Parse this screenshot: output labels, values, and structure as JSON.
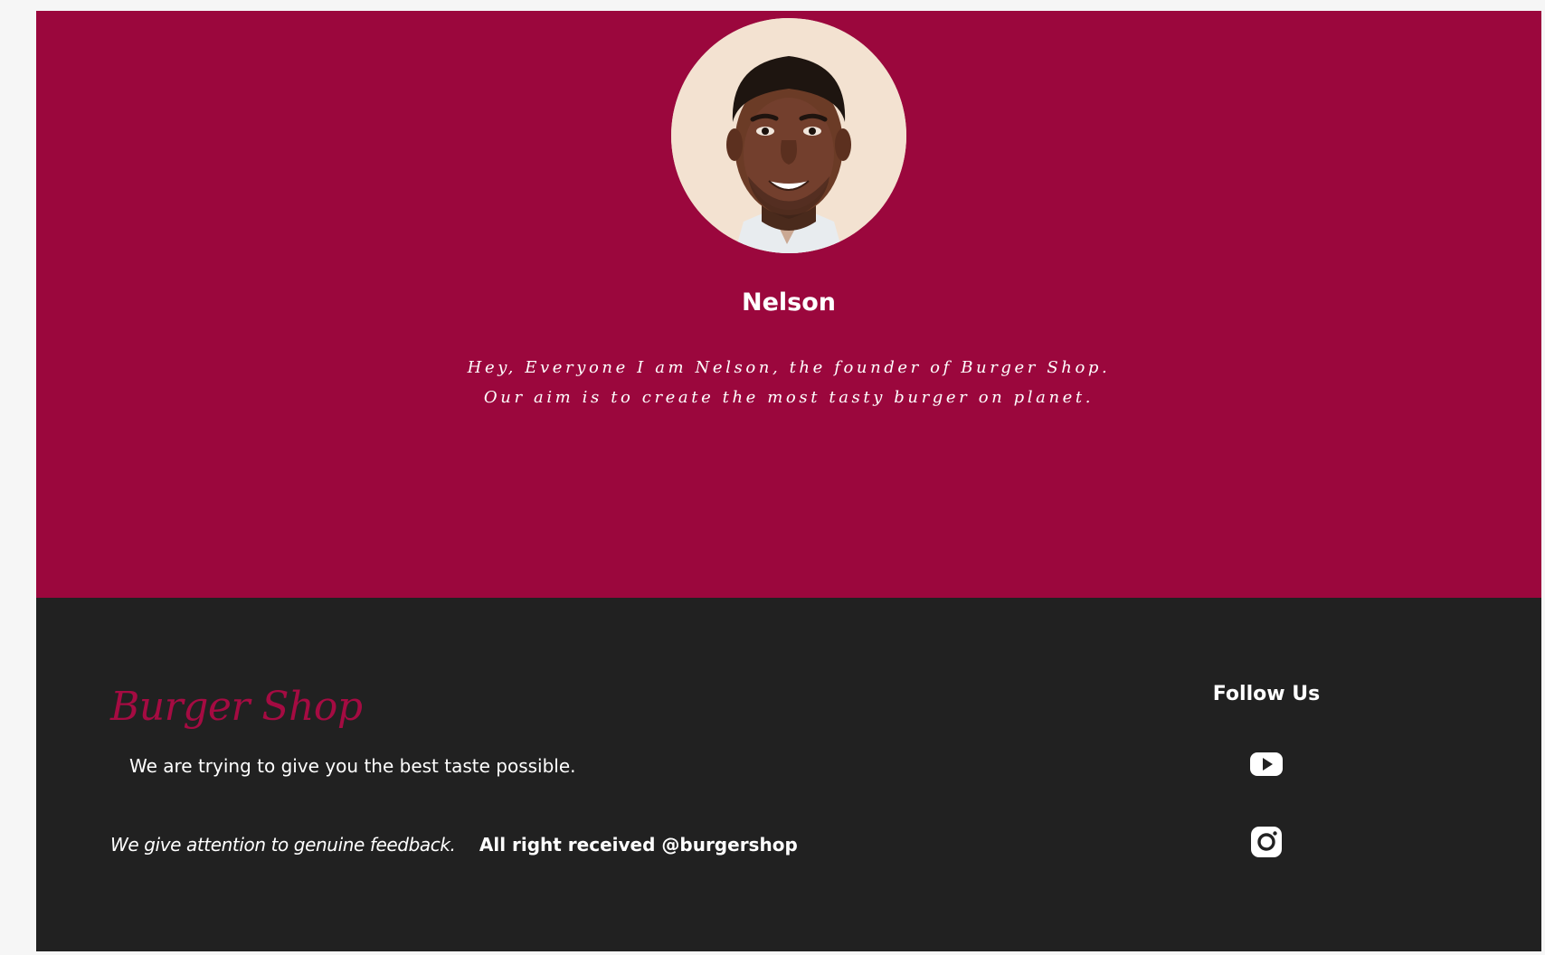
{
  "founder": {
    "name": "Nelson",
    "bio_line_1": "Hey, Everyone I am Nelson, the founder of Burger Shop.",
    "bio_line_2": "Our aim is to create the most tasty burger on planet.",
    "section_color": "#9b073d"
  },
  "footer": {
    "brand": "Burger Shop",
    "brand_color": "#a50b42",
    "tagline": "We are trying to give you the best taste possible.",
    "feedback": "We give attention to genuine feedback.",
    "rights": "All right received @burgershop",
    "background_color": "#212121",
    "follow": {
      "title": "Follow Us",
      "links": [
        {
          "icon": "youtube-icon"
        },
        {
          "icon": "instagram-icon"
        }
      ]
    }
  }
}
